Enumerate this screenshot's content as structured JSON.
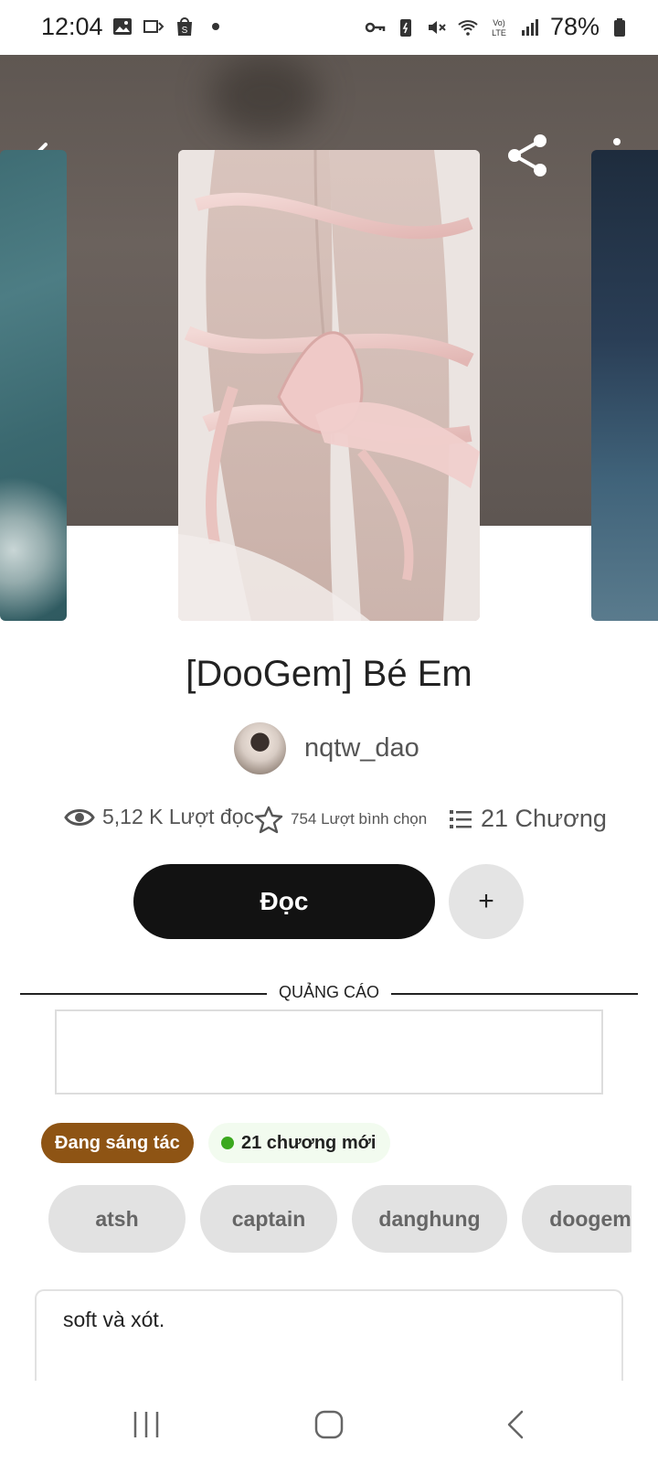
{
  "status_bar": {
    "time": "12:04",
    "battery_percent": "78%",
    "left_icons": [
      "gallery-icon",
      "cast-icon",
      "shopee-icon",
      "dot-icon"
    ],
    "right_icons": [
      "key-icon",
      "battery-saver-icon",
      "mute-icon",
      "wifi-icon",
      "volte-icon",
      "signal-icon",
      "battery-icon"
    ]
  },
  "toolbar": {
    "back_icon": "arrow-left-icon",
    "share_icon": "share-icon",
    "more_icon": "more-vertical-icon"
  },
  "story": {
    "title": "[DooGem] Bé Em",
    "author": "nqtw_dao",
    "stats": {
      "reads": "5,12 K Lượt đọc",
      "votes": "754 Lượt bình chọn",
      "parts": "21 Chương"
    },
    "read_button": "Đọc",
    "add_button": "+",
    "status": "Đang sáng tác",
    "new_parts": "21 chương mới",
    "tags": [
      "atsh",
      "captain",
      "danghung",
      "doogem"
    ],
    "description": "soft và xót."
  },
  "ad": {
    "label": "QUẢNG CÁO"
  },
  "colors": {
    "status_pill": "#8e5414",
    "new_dot": "#3ba81e",
    "read_button": "#121212"
  }
}
